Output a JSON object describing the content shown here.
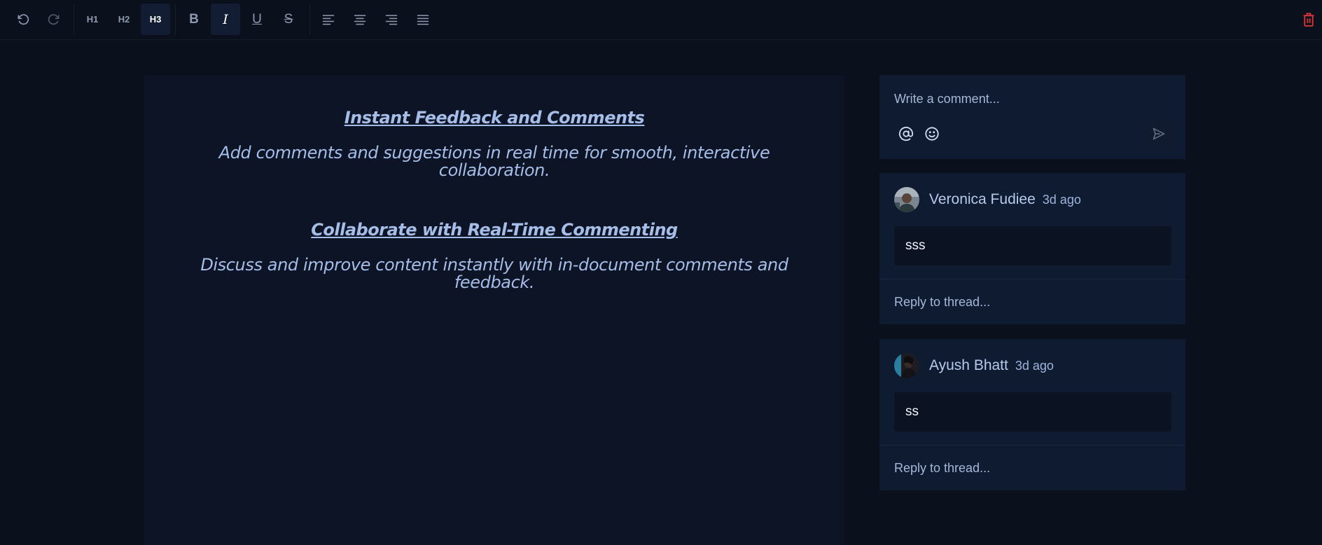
{
  "toolbar": {
    "undo_icon": "undo-icon",
    "redo_icon": "redo-icon",
    "headings": [
      "H1",
      "H2",
      "H3"
    ],
    "active_heading": "H3",
    "bold_label": "B",
    "italic_label": "I",
    "underline_label": "U",
    "strike_label": "S",
    "align_icons": [
      "align-left-icon",
      "align-center-icon",
      "align-right-icon",
      "align-justify-icon"
    ],
    "delete_icon": "trash-icon",
    "accent_color": "#e0363b"
  },
  "document": {
    "sections": [
      {
        "heading": "Instant Feedback and Comments",
        "body": "Add comments and suggestions in real time for smooth, interactive collaboration."
      },
      {
        "heading": "Collaborate with Real-Time Commenting",
        "body": "Discuss and improve content instantly with in-document comments and feedback."
      }
    ]
  },
  "comments": {
    "composer": {
      "placeholder": "Write a comment...",
      "mention_icon": "at-sign-icon",
      "emoji_icon": "smiley-icon",
      "send_icon": "send-icon"
    },
    "threads": [
      {
        "author": "Veronica Fudiee",
        "time": "3d ago",
        "body": "sss",
        "reply_placeholder": "Reply to thread..."
      },
      {
        "author": "Ayush Bhatt",
        "time": "3d ago",
        "body": "ss",
        "reply_placeholder": "Reply to thread..."
      }
    ]
  }
}
